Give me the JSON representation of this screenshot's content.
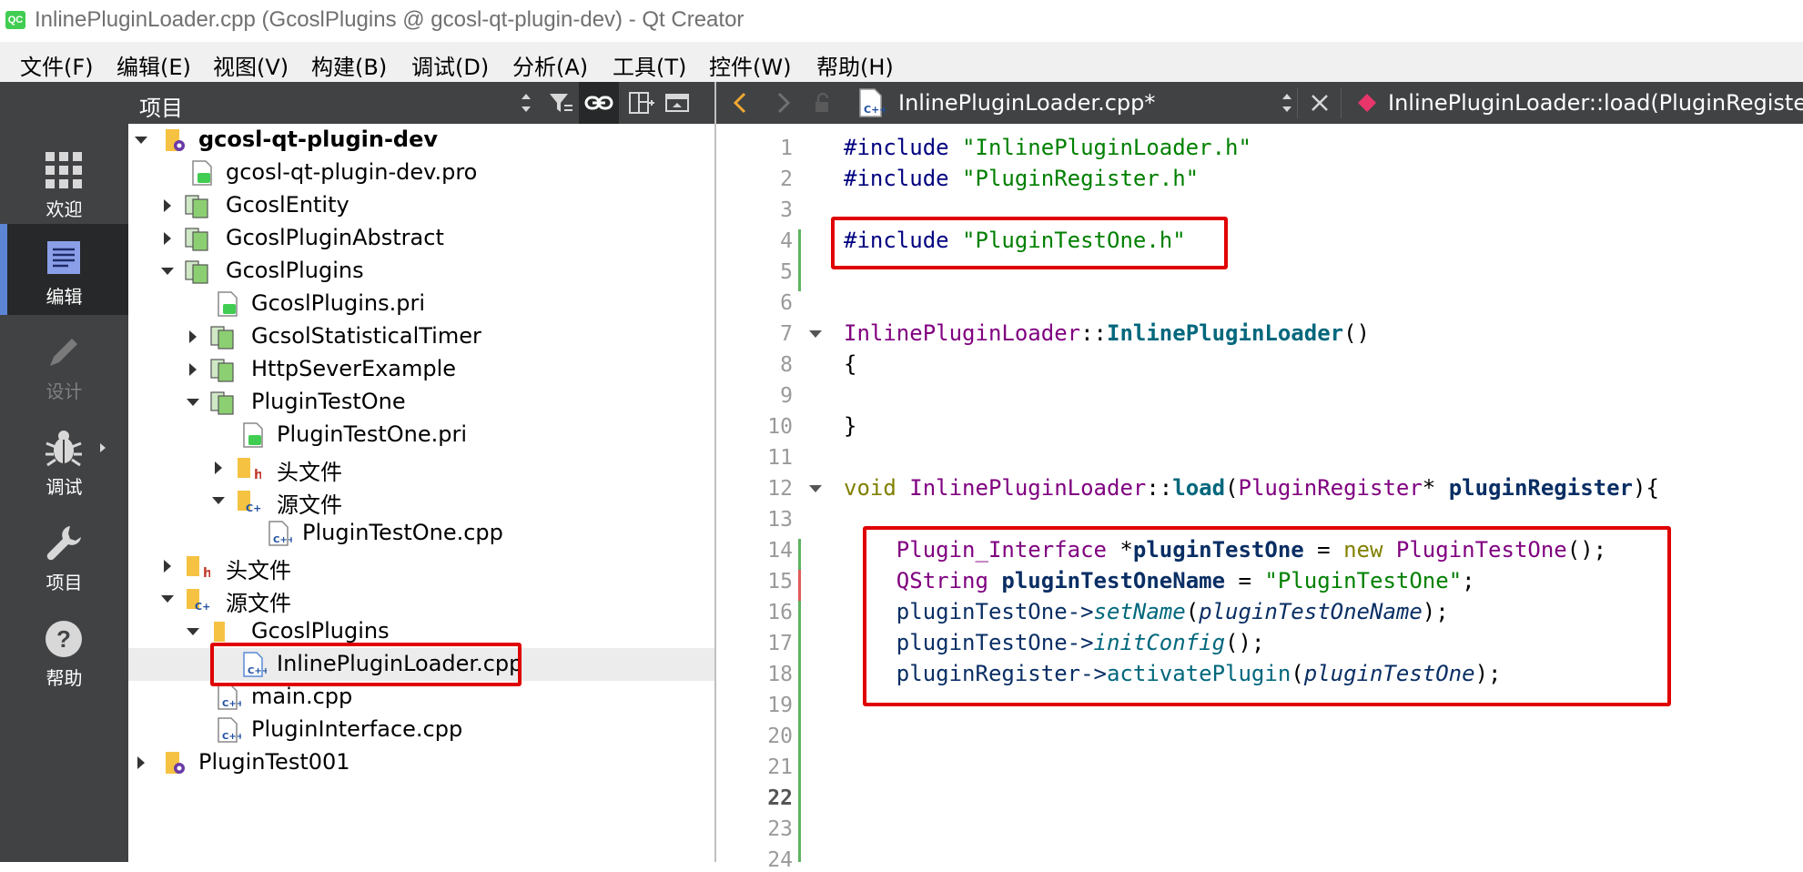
{
  "window": {
    "logo": "QC",
    "title": "InlinePluginLoader.cpp (GcoslPlugins @ gcosl-qt-plugin-dev) - Qt Creator"
  },
  "menu": [
    "文件(F)",
    "编辑(E)",
    "视图(V)",
    "构建(B)",
    "调试(D)",
    "分析(A)",
    "工具(T)",
    "控件(W)",
    "帮助(H)"
  ],
  "modes": [
    {
      "label": "欢迎",
      "icon": "grid-icon"
    },
    {
      "label": "编辑",
      "icon": "document-icon"
    },
    {
      "label": "设计",
      "icon": "pencil-icon"
    },
    {
      "label": "调试",
      "icon": "bug-icon"
    },
    {
      "label": "项目",
      "icon": "wrench-icon"
    },
    {
      "label": "帮助",
      "icon": "help-icon"
    }
  ],
  "project_panel": {
    "title": "项目",
    "tree": [
      {
        "label": "gcosl-qt-plugin-dev",
        "icon": "project-icon",
        "expanded": true
      },
      {
        "label": "gcosl-qt-plugin-dev.pro",
        "icon": "qt-file-icon"
      },
      {
        "label": "GcoslEntity",
        "icon": "subproject-icon",
        "expanded": false
      },
      {
        "label": "GcoslPluginAbstract",
        "icon": "subproject-icon",
        "expanded": false
      },
      {
        "label": "GcoslPlugins",
        "icon": "subproject-icon",
        "expanded": true
      },
      {
        "label": "GcoslPlugins.pri",
        "icon": "qt-file-icon"
      },
      {
        "label": "GcsolStatisticalTimer",
        "icon": "subproject-icon",
        "expanded": false
      },
      {
        "label": "HttpSeverExample",
        "icon": "subproject-icon",
        "expanded": false
      },
      {
        "label": "PluginTestOne",
        "icon": "subproject-icon",
        "expanded": true
      },
      {
        "label": "PluginTestOne.pri",
        "icon": "qt-file-icon"
      },
      {
        "label": "头文件",
        "icon": "header-folder-icon",
        "expanded": false
      },
      {
        "label": "源文件",
        "icon": "source-folder-icon",
        "expanded": true
      },
      {
        "label": "PluginTestOne.cpp",
        "icon": "cpp-file-icon"
      },
      {
        "label": "头文件",
        "icon": "header-folder-icon",
        "expanded": false
      },
      {
        "label": "源文件",
        "icon": "source-folder-icon",
        "expanded": true
      },
      {
        "label": "GcoslPlugins",
        "icon": "folder-icon",
        "expanded": true
      },
      {
        "label": "InlinePluginLoader.cpp",
        "icon": "cpp-file-icon",
        "selected": true
      },
      {
        "label": "main.cpp",
        "icon": "cpp-file-icon"
      },
      {
        "label": "PluginInterface.cpp",
        "icon": "cpp-file-icon"
      },
      {
        "label": "PluginTest001",
        "icon": "project-icon",
        "expanded": false
      }
    ]
  },
  "editor": {
    "file_label": "InlinePluginLoader.cpp*",
    "symbol_label": "InlinePluginLoader::load(PluginRegister",
    "line_numbers": [
      "1",
      "2",
      "3",
      "4",
      "5",
      "6",
      "7",
      "8",
      "9",
      "10",
      "11",
      "12",
      "13",
      "14",
      "15",
      "16",
      "17",
      "18",
      "19",
      "20",
      "21",
      "22",
      "23",
      "24"
    ],
    "current_line": "22",
    "code": {
      "l1_a": "#include ",
      "l1_b": "\"InlinePluginLoader.h\"",
      "l2_a": "#include ",
      "l2_b": "\"PluginRegister.h\"",
      "l4_a": "#include ",
      "l4_b": "\"PluginTestOne.h\"",
      "l7_a": "InlinePluginLoader",
      "l7_b": "::",
      "l7_c": "InlinePluginLoader",
      "l7_d": "()",
      "l8": "{",
      "l10": "}",
      "l12_a": "void",
      "l12_b": " ",
      "l12_c": "InlinePluginLoader",
      "l12_d": "::",
      "l12_e": "load",
      "l12_f": "(",
      "l12_g": "PluginRegister",
      "l12_h": "* ",
      "l12_i": "pluginRegister",
      "l12_j": "){",
      "l14_a": "    Plugin_Interface",
      "l14_b": " *",
      "l14_c": "pluginTestOne",
      "l14_d": " = ",
      "l14_e": "new",
      "l14_f": " ",
      "l14_g": "PluginTestOne",
      "l14_h": "();",
      "l15_a": "    QString",
      "l15_b": " ",
      "l15_c": "pluginTestOneName",
      "l15_d": " = ",
      "l15_e": "\"PluginTestOne\"",
      "l15_f": ";",
      "l16_a": "    pluginTestOne->",
      "l16_b": "setName",
      "l16_c": "(",
      "l16_d": "pluginTestOneName",
      "l16_e": ");",
      "l17_a": "    pluginTestOne->",
      "l17_b": "initConfig",
      "l17_c": "();",
      "l18_a": "    pluginRegister->",
      "l18_b": "activatePlugin",
      "l18_c": "(",
      "l18_d": "pluginTestOne",
      "l18_e": ");"
    }
  },
  "colors": {
    "highlight": "#e00000",
    "sidebar": "#404244",
    "selection_bar": "#5c85d6",
    "change_marker": "#5fb35f"
  }
}
